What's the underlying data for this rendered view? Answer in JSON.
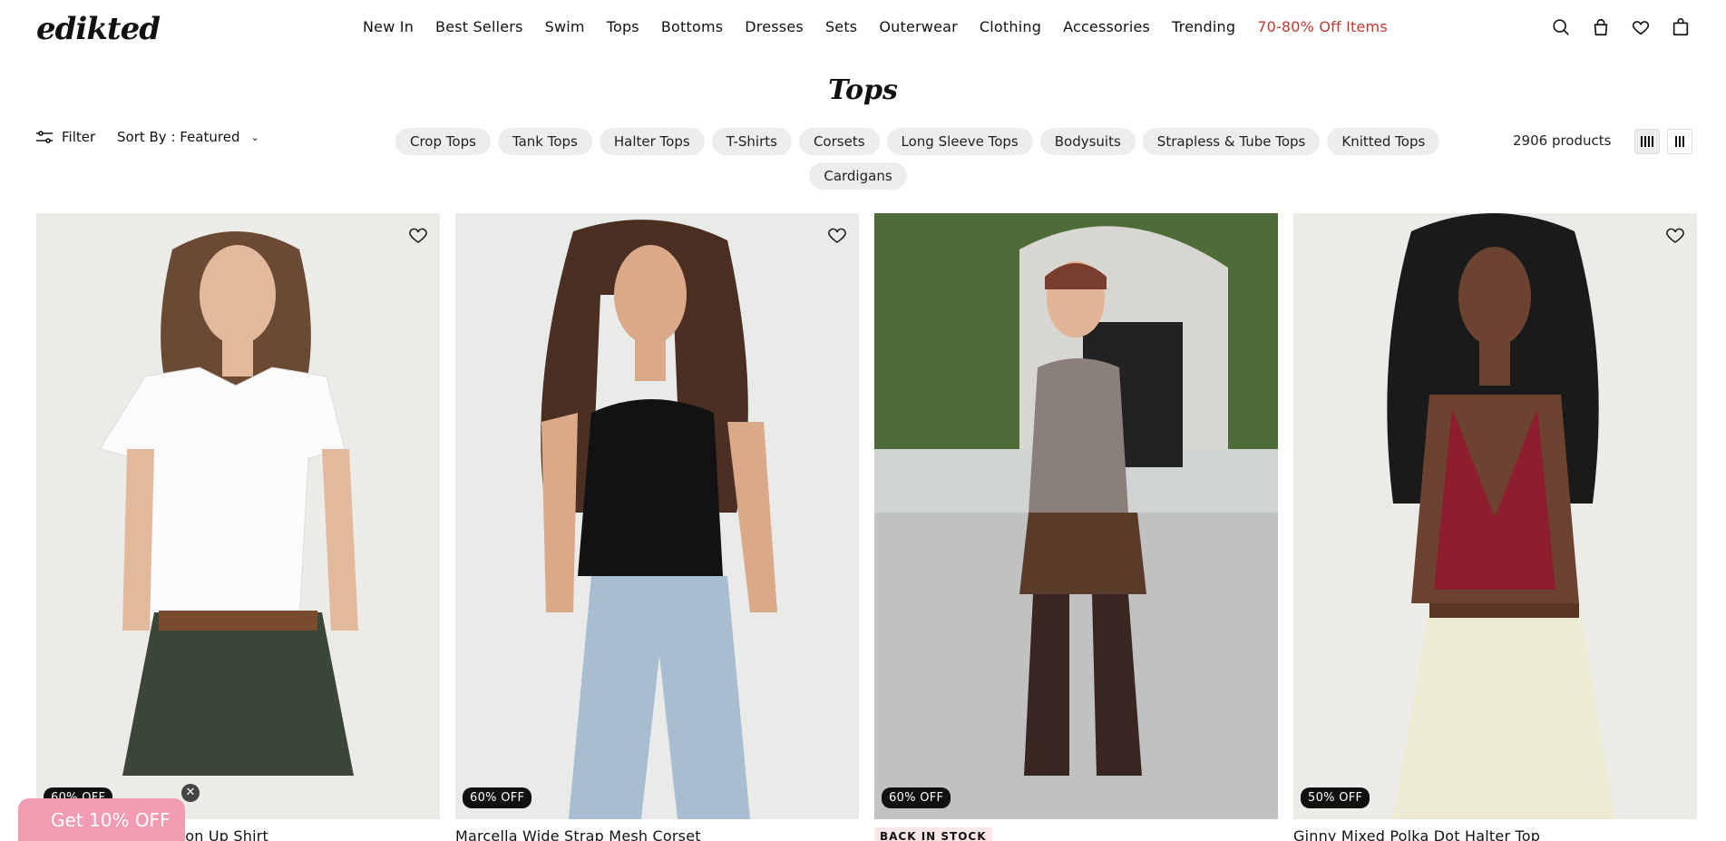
{
  "brand": {
    "logo_text": "edikted"
  },
  "nav": {
    "items": [
      {
        "label": "New In"
      },
      {
        "label": "Best Sellers"
      },
      {
        "label": "Swim"
      },
      {
        "label": "Tops"
      },
      {
        "label": "Bottoms"
      },
      {
        "label": "Dresses"
      },
      {
        "label": "Sets"
      },
      {
        "label": "Outerwear"
      },
      {
        "label": "Clothing"
      },
      {
        "label": "Accessories"
      },
      {
        "label": "Trending"
      },
      {
        "label": "70-80% Off Items"
      }
    ],
    "sale_color": "#c0392b"
  },
  "header_icons": [
    "search-icon",
    "account-icon",
    "heart-icon",
    "cart-icon"
  ],
  "page": {
    "title": "Tops"
  },
  "toolbar": {
    "filter_label": "Filter",
    "sort_label": "Sort By : Featured",
    "product_count": "2906 products"
  },
  "categories": {
    "row1": [
      "Crop Tops",
      "Tank Tops",
      "Halter Tops",
      "T-Shirts",
      "Corsets",
      "Long Sleeve Tops",
      "Bodysuits",
      "Strapless & Tube Tops",
      "Knitted Tops"
    ],
    "row2": [
      "Cardigans"
    ]
  },
  "products": [
    {
      "name": "Massie Tailored Button Up Shirt",
      "badge": "60% OFF"
    },
    {
      "name": "Marcella Wide Strap Mesh Corset",
      "badge": "60% OFF"
    },
    {
      "name": "",
      "badge": "60% OFF",
      "status": "BACK IN STOCK"
    },
    {
      "name": "Ginny Mixed Polka Dot Halter Top",
      "badge": "50% OFF"
    }
  ],
  "promo": {
    "label": "Get 10% OFF",
    "close_glyph": "✕",
    "color": "#f29cb2"
  }
}
